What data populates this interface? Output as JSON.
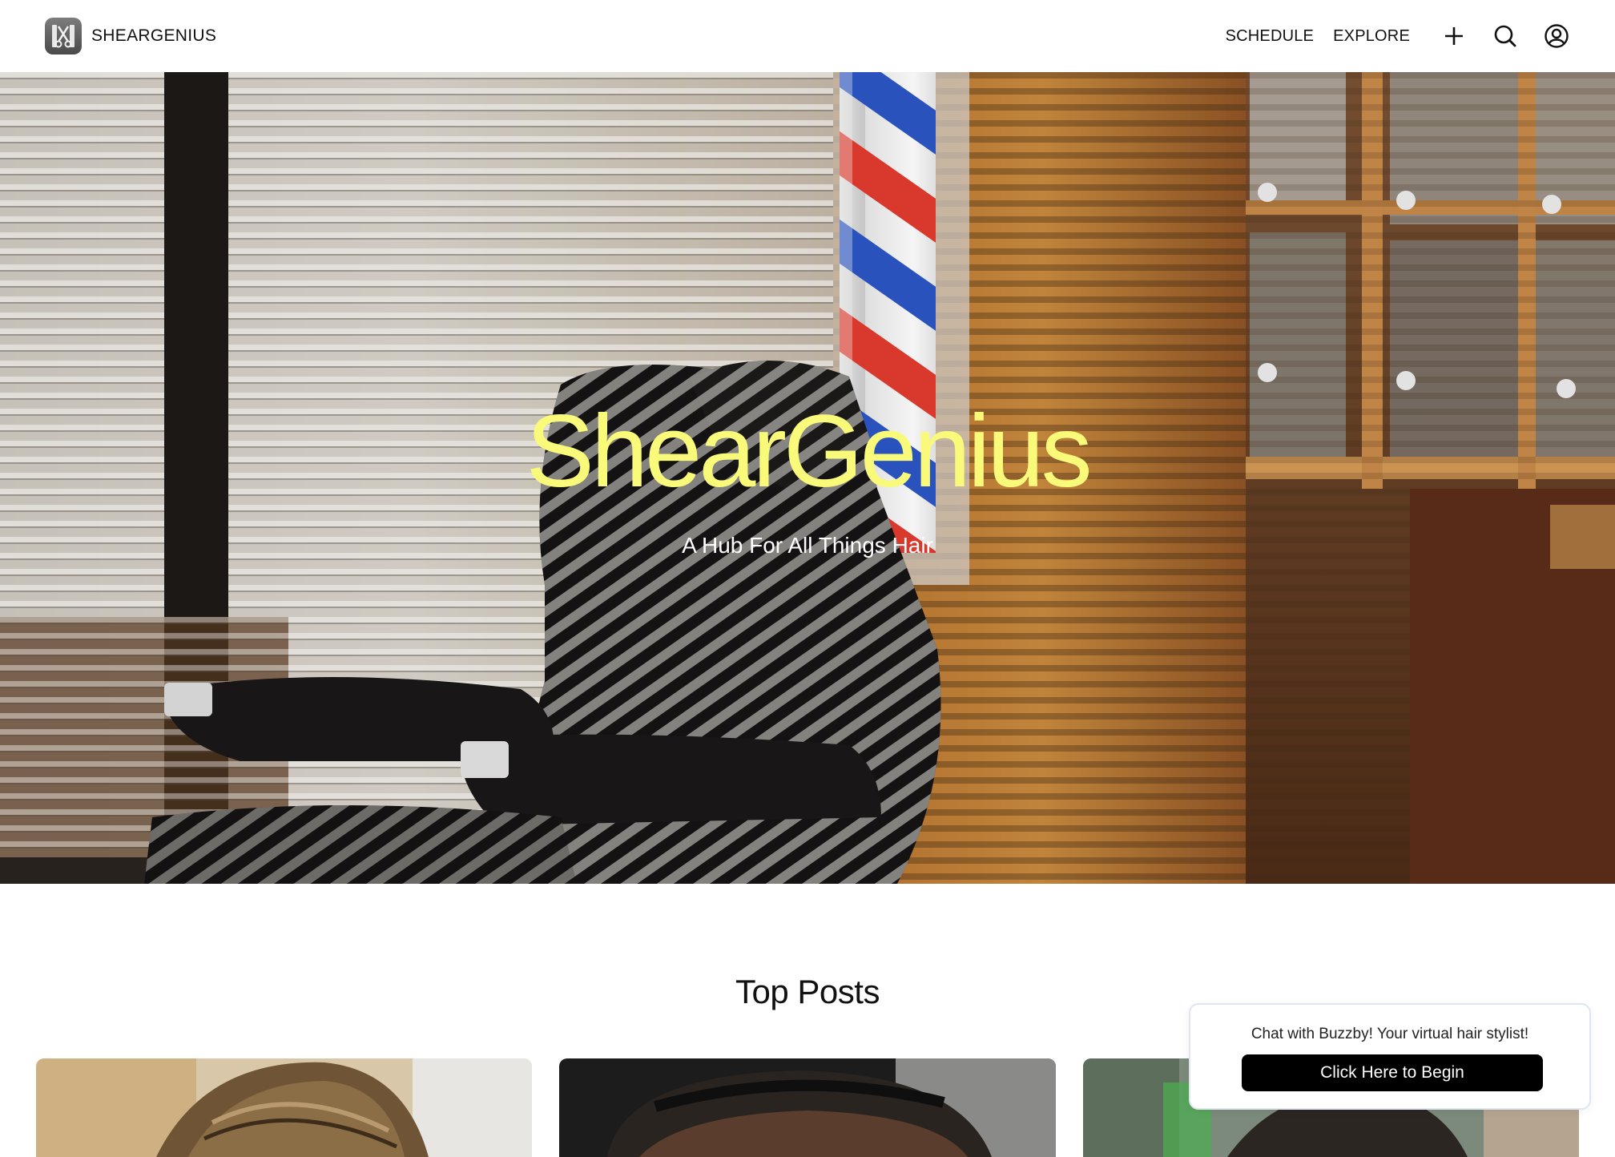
{
  "header": {
    "brand": "SHEARGENIUS",
    "nav": {
      "schedule": "SCHEDULE",
      "explore": "EXPLORE"
    },
    "icons": [
      "plus-icon",
      "search-icon",
      "account-icon"
    ]
  },
  "hero": {
    "title": "ShearGenius",
    "subtitle": "A Hub For All Things Hair",
    "title_color": "#fafa7a"
  },
  "top_posts": {
    "title": "Top Posts",
    "posts": [
      {
        "image": "hair-photo-1"
      },
      {
        "image": "hair-photo-2"
      },
      {
        "image": "hair-photo-3"
      }
    ]
  },
  "chat": {
    "message": "Chat with Buzzby! Your virtual hair stylist!",
    "button_label": "Click Here to Begin"
  }
}
